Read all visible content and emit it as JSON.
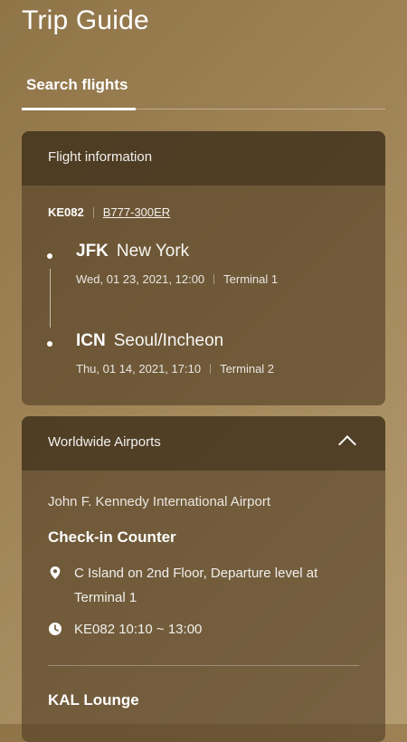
{
  "header": {
    "title": "Trip Guide"
  },
  "tabs": [
    {
      "label": "Search flights",
      "active": true
    }
  ],
  "flight_card": {
    "title": "Flight information",
    "flight_number": "KE082",
    "aircraft": "B777-300ER",
    "departure": {
      "code": "JFK",
      "city": "New York",
      "datetime": "Wed, 01 23, 2021, 12:00",
      "terminal": "Terminal 1"
    },
    "arrival": {
      "code": "ICN",
      "city": "Seoul/Incheon",
      "datetime": "Thu, 01 14, 2021, 17:10",
      "terminal": "Terminal 2"
    }
  },
  "airports_card": {
    "title": "Worldwide Airports",
    "expanded": true,
    "airport_name": "John F. Kennedy International Airport",
    "checkin": {
      "title": "Check-in Counter",
      "location_line1": "C Island on 2nd Floor, Departure level at",
      "location_line2": "Terminal 1",
      "hours": "KE082 10:10 ~ 13:00"
    },
    "lounge": {
      "title": "KAL Lounge"
    }
  },
  "icons": {
    "location": "location-pin-icon",
    "time": "clock-icon",
    "collapse": "chevron-up-icon"
  }
}
